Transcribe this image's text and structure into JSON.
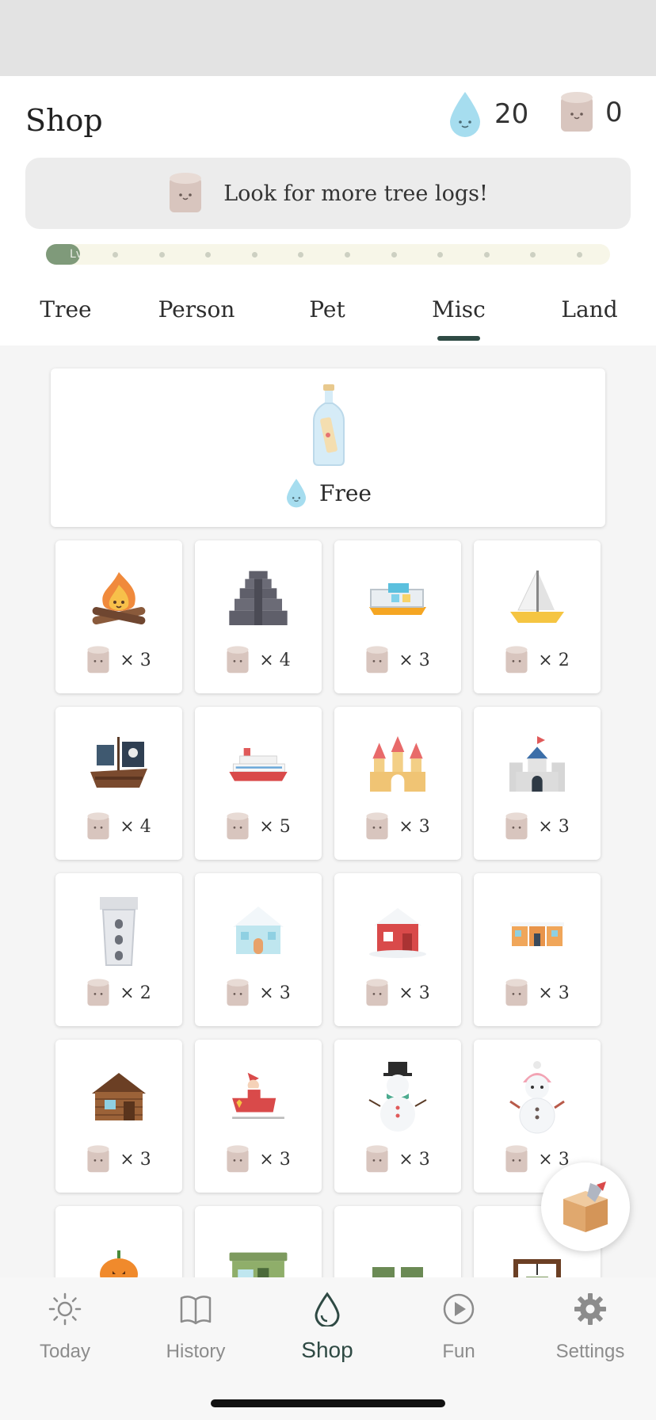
{
  "header": {
    "title": "Shop",
    "water_count": "20",
    "log_count": "0"
  },
  "banner": {
    "text": "Look for more tree logs!"
  },
  "level": {
    "label": "Lv",
    "progress": 0.06
  },
  "tabs": [
    {
      "label": "Tree",
      "active": false
    },
    {
      "label": "Person",
      "active": false
    },
    {
      "label": "Pet",
      "active": false
    },
    {
      "label": "Misc",
      "active": true
    },
    {
      "label": "Land",
      "active": false
    }
  ],
  "featured": {
    "name": "message-bottle",
    "price_label": "Free"
  },
  "items": [
    {
      "name": "campfire",
      "cost": "× 3"
    },
    {
      "name": "pyramid",
      "cost": "× 4"
    },
    {
      "name": "house-boat",
      "cost": "× 3"
    },
    {
      "name": "sailboat",
      "cost": "× 2"
    },
    {
      "name": "pirate-ship",
      "cost": "× 4"
    },
    {
      "name": "cruise-ship",
      "cost": "× 5"
    },
    {
      "name": "sand-castle",
      "cost": "× 3"
    },
    {
      "name": "stone-castle",
      "cost": "× 3"
    },
    {
      "name": "tower",
      "cost": "× 2"
    },
    {
      "name": "ice-house",
      "cost": "× 3"
    },
    {
      "name": "snowy-red-house",
      "cost": "× 3"
    },
    {
      "name": "snowy-village",
      "cost": "× 3"
    },
    {
      "name": "log-cabin",
      "cost": "× 3"
    },
    {
      "name": "santa-sleigh",
      "cost": "× 3"
    },
    {
      "name": "snowman",
      "cost": "× 3"
    },
    {
      "name": "pink-snowman",
      "cost": "× 3"
    },
    {
      "name": "pumpkin",
      "cost": ""
    },
    {
      "name": "camper-van",
      "cost": ""
    },
    {
      "name": "camp-chairs",
      "cost": ""
    },
    {
      "name": "campfire-pot",
      "cost": ""
    }
  ],
  "nav": [
    {
      "label": "Today",
      "icon": "sun-icon",
      "active": false
    },
    {
      "label": "History",
      "icon": "book-icon",
      "active": false
    },
    {
      "label": "Shop",
      "icon": "drop-icon",
      "active": true
    },
    {
      "label": "Fun",
      "icon": "play-icon",
      "active": false
    },
    {
      "label": "Settings",
      "icon": "gear-icon",
      "active": false
    }
  ],
  "colors": {
    "accent": "#2f4a44",
    "water": "#9fdcef",
    "log": "#d9c6bf",
    "level_fill": "#7f9a7a"
  }
}
